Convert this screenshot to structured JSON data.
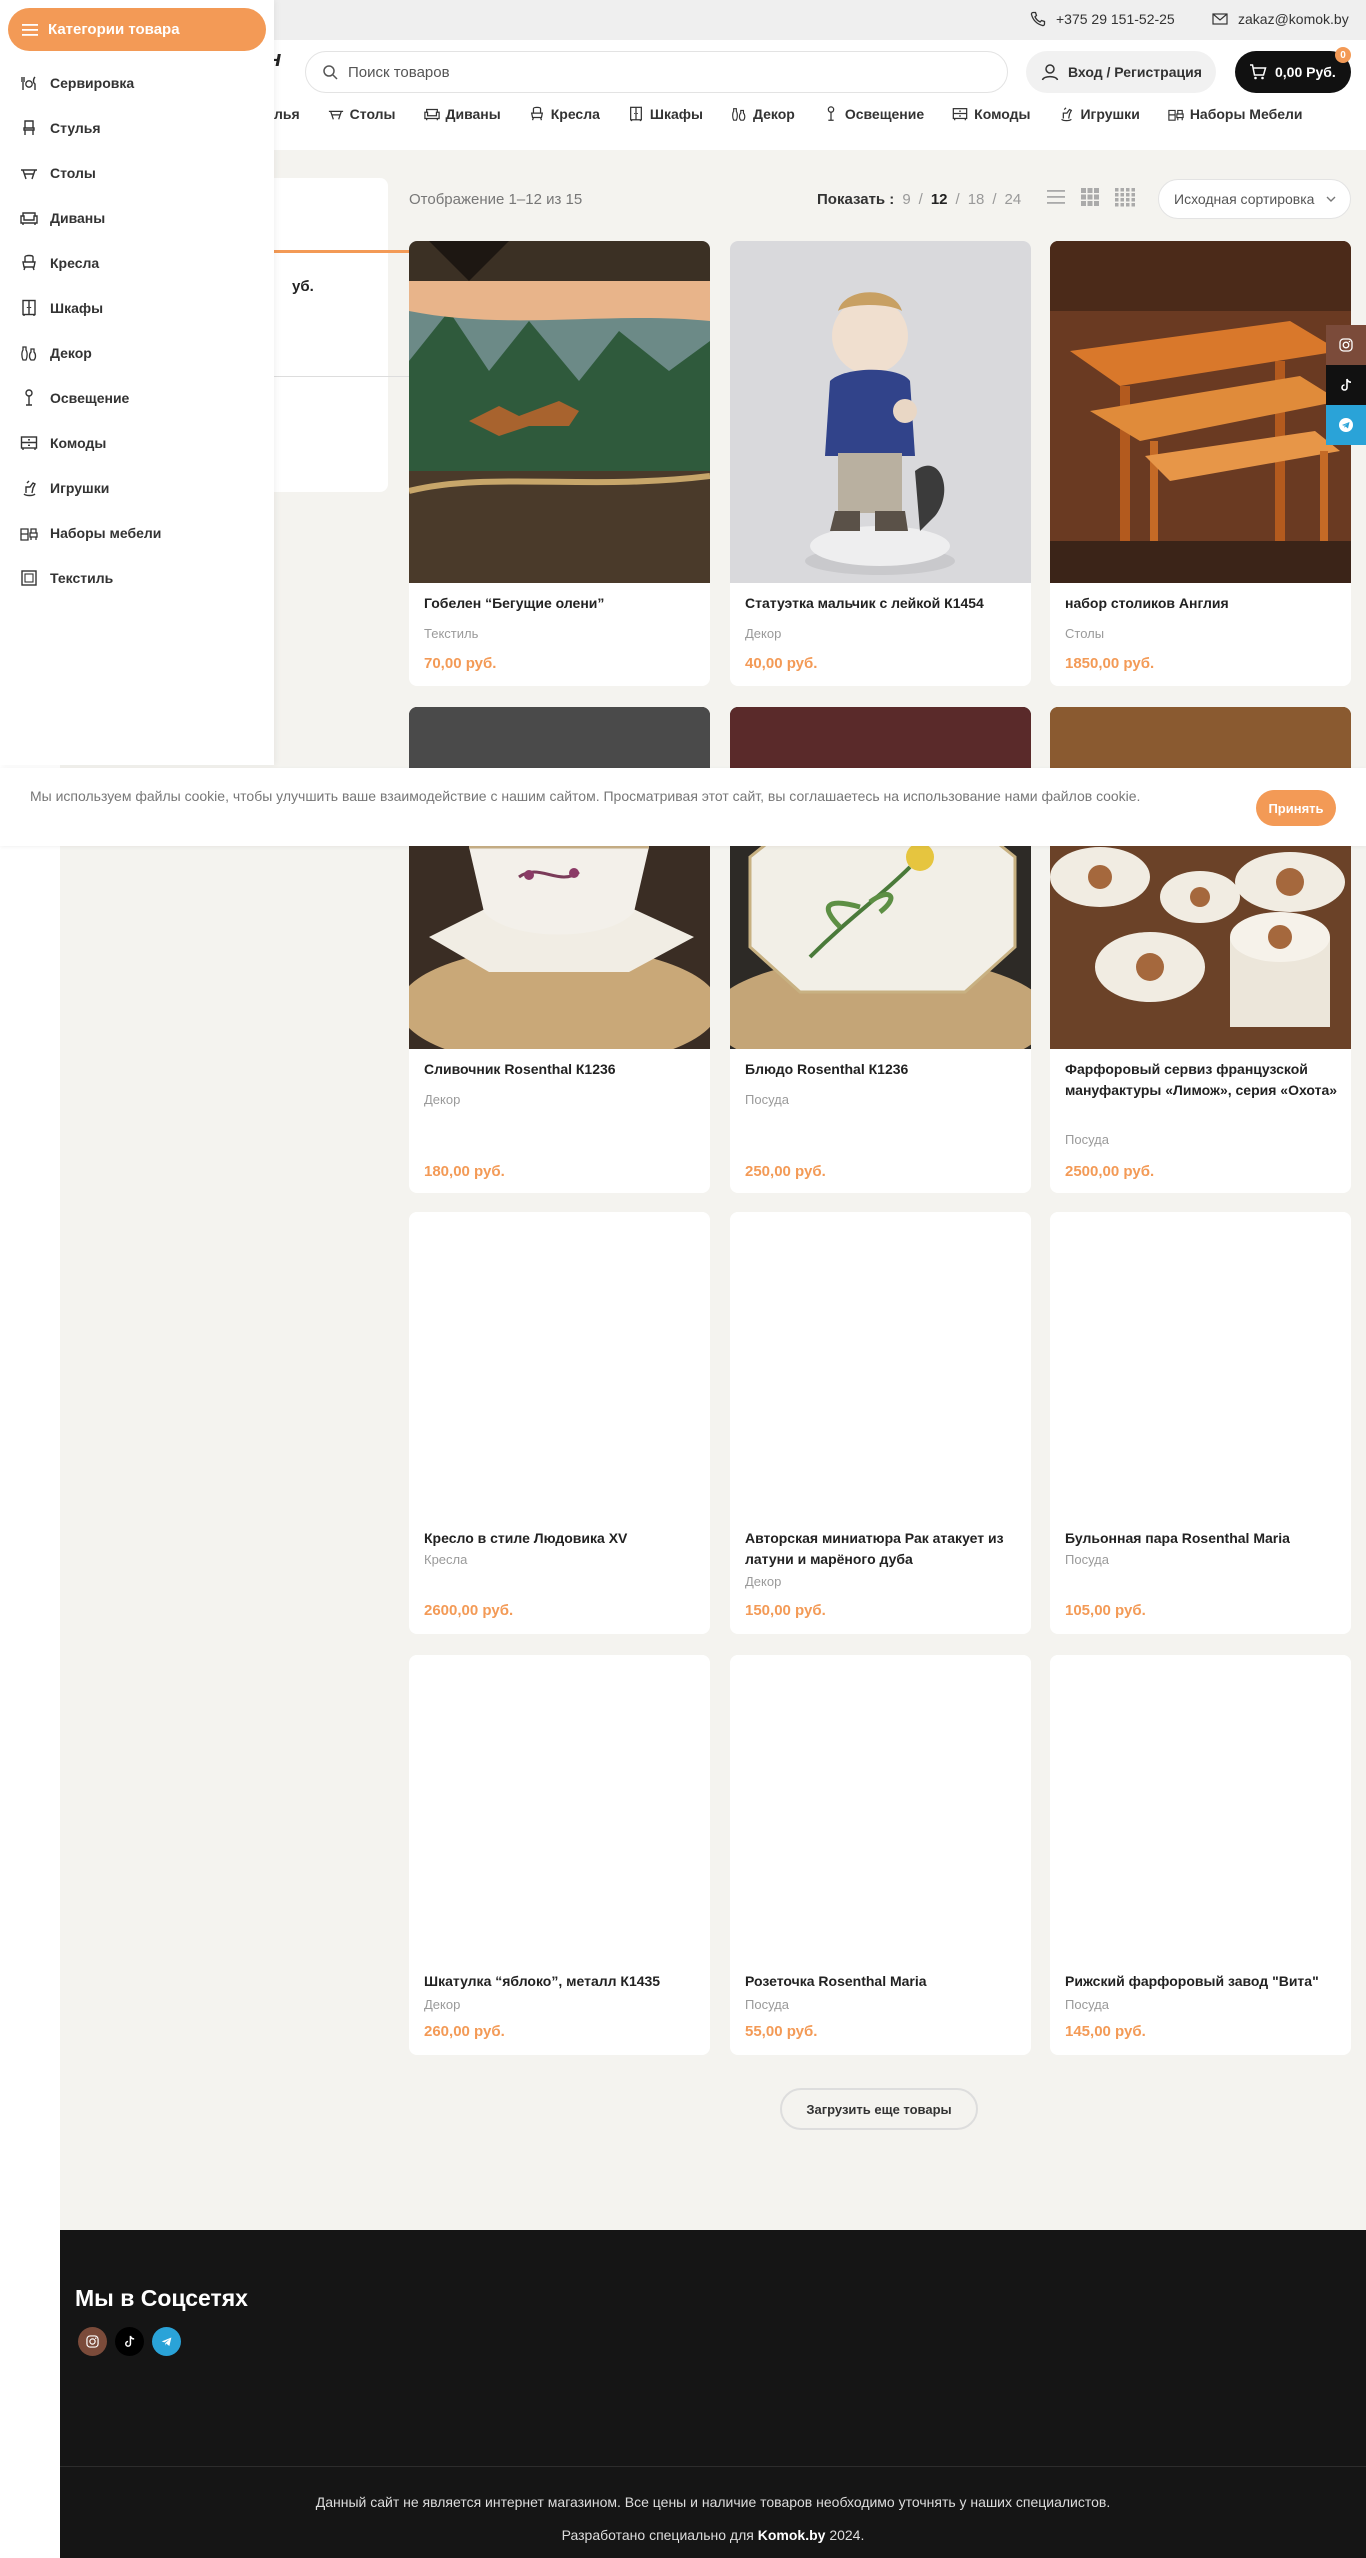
{
  "topbar": {
    "phone": "+375 29 151-52-25",
    "email": "zakaz@komok.by"
  },
  "header": {
    "logo_fragment": "н",
    "search_placeholder": "Поиск товаров",
    "login_label": "Вход / Регистрация",
    "cart_total": "0,00 Руб.",
    "cart_count": "0"
  },
  "category_nav": [
    {
      "label": "лья",
      "icon": "chair-icon"
    },
    {
      "label": "Столы",
      "icon": "table-icon"
    },
    {
      "label": "Диваны",
      "icon": "sofa-icon"
    },
    {
      "label": "Кресла",
      "icon": "armchair-icon"
    },
    {
      "label": "Шкафы",
      "icon": "wardrobe-icon"
    },
    {
      "label": "Декор",
      "icon": "vase-icon"
    },
    {
      "label": "Освещение",
      "icon": "lamp-icon"
    },
    {
      "label": "Комоды",
      "icon": "dresser-icon"
    },
    {
      "label": "Игрушки",
      "icon": "toy-horse-icon"
    },
    {
      "label": "Наборы Мебели",
      "icon": "furniture-set-icon"
    }
  ],
  "drawer": {
    "button_label": "Категории товара",
    "items": [
      {
        "label": "Сервировка",
        "icon": "tableware-icon"
      },
      {
        "label": "Стулья",
        "icon": "chair-icon"
      },
      {
        "label": "Столы",
        "icon": "table-icon"
      },
      {
        "label": "Диваны",
        "icon": "sofa-icon"
      },
      {
        "label": "Кресла",
        "icon": "armchair-icon"
      },
      {
        "label": "Шкафы",
        "icon": "wardrobe-icon"
      },
      {
        "label": "Декор",
        "icon": "vase-icon"
      },
      {
        "label": "Освещение",
        "icon": "lamp-icon"
      },
      {
        "label": "Комоды",
        "icon": "dresser-icon"
      },
      {
        "label": "Игрушки",
        "icon": "toy-horse-icon"
      },
      {
        "label": "Наборы мебели",
        "icon": "furniture-set-icon"
      },
      {
        "label": "Текстиль",
        "icon": "textile-icon"
      }
    ]
  },
  "filter": {
    "price_fragment": "уб."
  },
  "toolbar": {
    "result_count": "Отображение 1–12 из 15",
    "show_label": "Показать :",
    "per_page": [
      "9",
      "12",
      "18",
      "24"
    ],
    "per_page_selected": "12",
    "sort_selected": "Исходная сортировка"
  },
  "products": [
    {
      "name": "Гобелен “Бегущие олени”",
      "category": "Текстиль",
      "price": "70,00 руб."
    },
    {
      "name": "Статуэтка мальчик с лейкой К1454",
      "category": "Декор",
      "price": "40,00 руб."
    },
    {
      "name": "набор столиков Англия",
      "category": "Столы",
      "price": "1850,00 руб."
    },
    {
      "name": "Сливочник Rosenthal К1236",
      "category": "Декор",
      "price": "180,00 руб."
    },
    {
      "name": "Блюдо Rosenthal К1236",
      "category": "Посуда",
      "price": "250,00 руб."
    },
    {
      "name": "Фарфоровый сервиз французской мануфактуры «Лимож», серия «Охота»",
      "category": "Посуда",
      "price": "2500,00 руб."
    },
    {
      "name": "Кресло в стиле Людовика XV",
      "category": "Кресла",
      "price": "2600,00 руб."
    },
    {
      "name": "Авторская миниатюра Рак атакует из латуни и марёного дуба",
      "category": "Декор",
      "price": "150,00 руб."
    },
    {
      "name": "Бульонная пара Rosenthal Maria",
      "category": "Посуда",
      "price": "105,00 руб."
    },
    {
      "name": "Шкатулка “яблоко”, металл К1435",
      "category": "Декор",
      "price": "260,00 руб."
    },
    {
      "name": "Розеточка Rosenthal Maria",
      "category": "Посуда",
      "price": "55,00 руб."
    },
    {
      "name": "Рижский фарфоровый завод \"Вита\"",
      "category": "Посуда",
      "price": "145,00 руб."
    }
  ],
  "load_more_label": "Загрузить еще товары",
  "cookie": {
    "text": "Мы используем файлы cookie, чтобы улучшить ваше взаимодействие с нашим сайтом. Просматривая этот сайт, вы соглашаетесь на использование нами файлов cookie.",
    "accept_label": "Принять"
  },
  "footer": {
    "social_title": "Мы в Соцсетях",
    "disclaimer": "Данный сайт не является интернет магазином. Все цены и наличие товаров необходимо уточнять у наших специалистов.",
    "developed_prefix": "Разработано специально для",
    "developed_brand": "Komok.by",
    "developed_year": "2024."
  },
  "colors": {
    "accent": "#f39a56",
    "dark": "#111111",
    "instagram": "#7b4b3a",
    "telegram": "#2aa3d8"
  }
}
